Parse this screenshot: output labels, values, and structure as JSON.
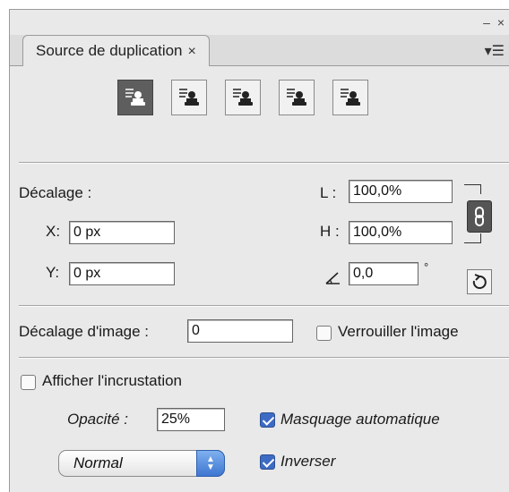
{
  "window": {
    "minimize_glyph": "–",
    "close_glyph": "×"
  },
  "tab": {
    "title": "Source de duplication",
    "close_glyph": "×",
    "menu_glyph": "▾☰"
  },
  "source_buttons": [
    {
      "icon": "clone-source-icon",
      "active": true
    },
    {
      "icon": "clone-source-icon",
      "active": false
    },
    {
      "icon": "clone-source-icon",
      "active": false
    },
    {
      "icon": "clone-source-icon",
      "active": false
    },
    {
      "icon": "clone-source-icon",
      "active": false
    }
  ],
  "offset": {
    "label": "Décalage :",
    "x_label": "X:",
    "x_value": "0 px",
    "y_label": "Y:",
    "y_value": "0 px",
    "w_label": "L :",
    "w_value": "100,0%",
    "h_label": "H :",
    "h_value": "100,0%",
    "angle_value": "0,0",
    "angle_unit": "°"
  },
  "frame_offset": {
    "label": "Décalage d'image :",
    "value": "0"
  },
  "lock_frame": {
    "label": "Verrouiller l'image",
    "checked": false
  },
  "overlay": {
    "show_label": "Afficher l'incrustation",
    "show_checked": false,
    "opacity_label": "Opacité :",
    "opacity_value": "25%",
    "auto_hide_label": "Masquage automatique",
    "auto_hide_checked": true,
    "invert_label": "Inverser",
    "invert_checked": true,
    "blend_mode": "Normal"
  },
  "colors": {
    "panel_bg": "#e9e9e9",
    "active_button": "#5e5e5e",
    "accent": "#3d6bc4"
  }
}
